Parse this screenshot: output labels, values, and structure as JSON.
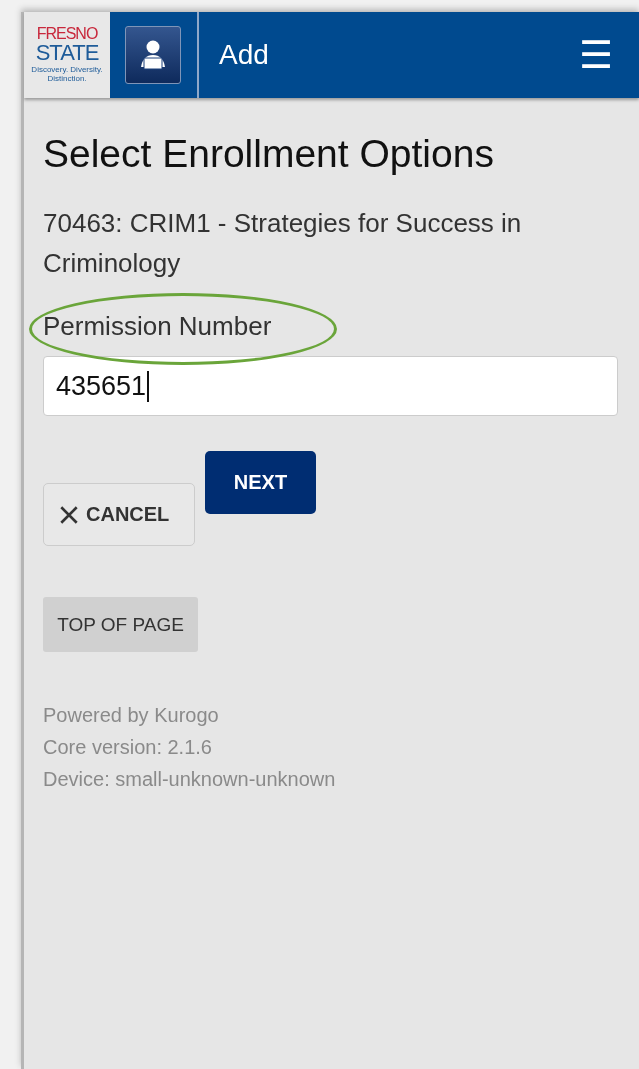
{
  "header": {
    "logo": {
      "line_1": "FRESNO",
      "line_2": "STATE",
      "tagline": "Discovery. Diversity. Distinction."
    },
    "title": "Add",
    "menu_icon": "☰"
  },
  "page": {
    "heading": "Select Enrollment Options",
    "course": "70463: CRIM1 - Strategies for Success in Criminology"
  },
  "form": {
    "field_label": "Permission Number",
    "label_circled": true,
    "value": "435651",
    "focused": true
  },
  "buttons": [
    {
      "label": "NEXT",
      "kind": "primary"
    },
    {
      "label": "CANCEL",
      "kind": "cancel"
    }
  ],
  "top_of_page": "TOP OF PAGE",
  "footer": [
    "Powered by Kurogo",
    "Core version: 2.1.6",
    "Device: small-unknown-unknown"
  ]
}
